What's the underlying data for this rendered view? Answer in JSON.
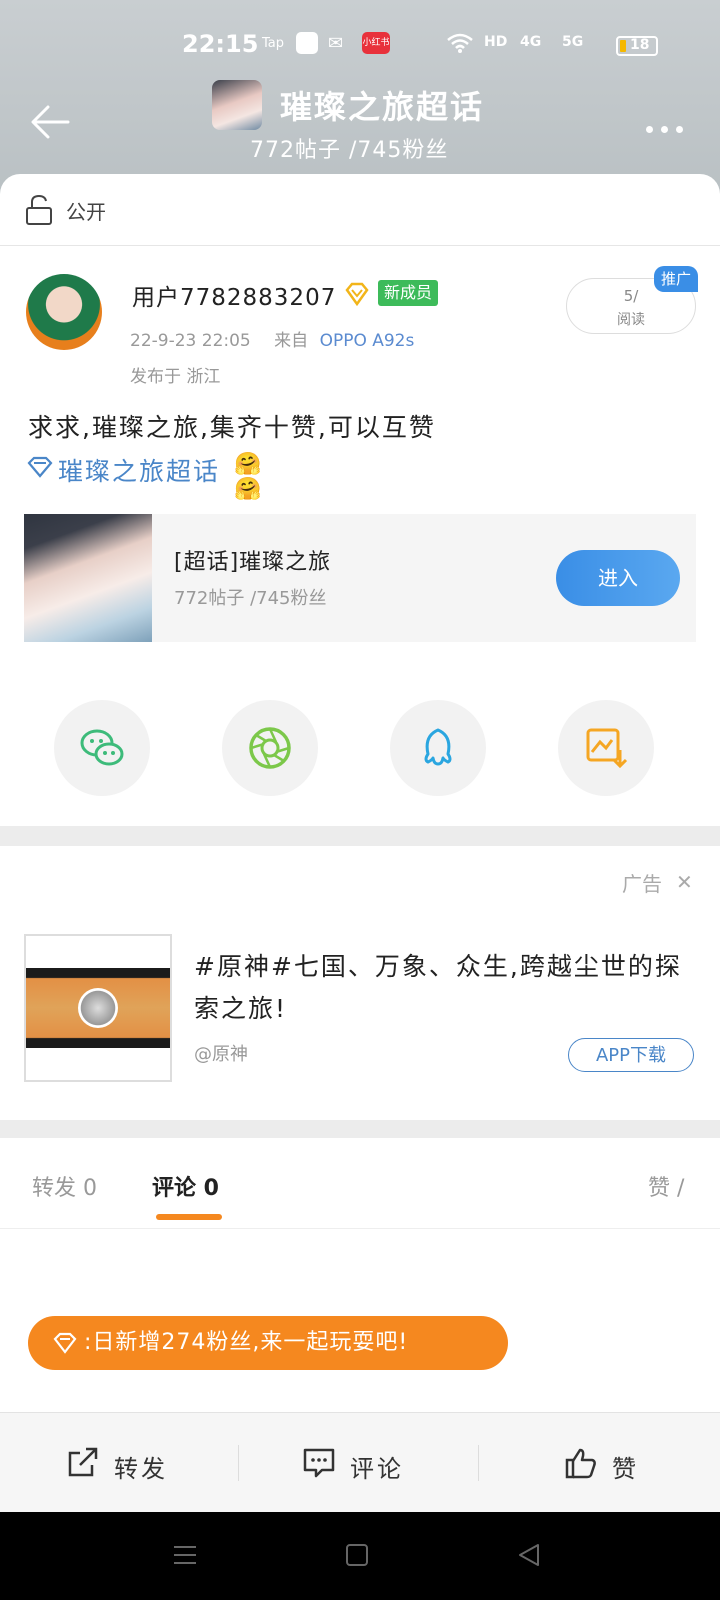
{
  "status_bar": {
    "time": "22:15",
    "apps": [
      "Tap",
      "小红书"
    ],
    "network": [
      "HD",
      "4G",
      "5G"
    ],
    "battery": "18"
  },
  "header": {
    "title": "璀璨之旅超话",
    "subtitle": "772帖子 /745粉丝"
  },
  "visibility": {
    "label": "公开"
  },
  "post": {
    "username": "用户7782883207",
    "badge": "新成员",
    "time": "22-9-23 22:05",
    "source_prefix": "来自",
    "device": "OPPO A92s",
    "location": "发布于 浙江",
    "read_count": "5/",
    "read_label": "阅读",
    "promo_badge": "推广",
    "text": "求求,璀璨之旅,集齐十赞,可以互赞",
    "topic": "璀璨之旅超话",
    "emojis": "🤗🤗"
  },
  "topic_card": {
    "title": "[超话]璀璨之旅",
    "subtitle": "772帖子 /745粉丝",
    "button": "进入"
  },
  "share_icons": [
    "wechat-icon",
    "moments-icon",
    "qq-icon",
    "save-image-icon"
  ],
  "ad": {
    "label": "广告",
    "close": "✕",
    "text": "#原神#七国、万象、众生,跨越尘世的探索之旅!",
    "source": "@原神",
    "download": "APP下载"
  },
  "tabs": {
    "forward": "转发 0",
    "comment": "评论 0",
    "like": "赞 /"
  },
  "toast": {
    "text": ":日新增274粉丝,来一起玩耍吧!"
  },
  "actions": {
    "forward": "转发",
    "comment": "评论",
    "like": "赞"
  },
  "colors": {
    "accent_orange": "#f5881f",
    "accent_blue": "#3a8ee6",
    "new_member_green": "#3dbb5a"
  }
}
